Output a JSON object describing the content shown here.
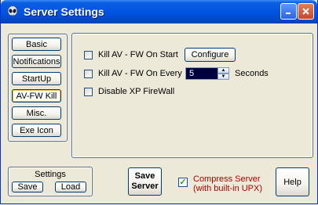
{
  "window": {
    "title": "Server Settings"
  },
  "tabs": [
    {
      "label": "Basic"
    },
    {
      "label": "Notifications"
    },
    {
      "label": "StartUp"
    },
    {
      "label": "AV-FW Kill",
      "active": true
    },
    {
      "label": "Misc."
    },
    {
      "label": "Exe Icon"
    }
  ],
  "av_fw": {
    "kill_on_start_label": "Kill AV - FW On Start",
    "configure_label": "Configure",
    "kill_every_label": "Kill AV - FW On Every",
    "kill_every_value": "5",
    "seconds_label": "Seconds",
    "disable_firewall_label": "Disable XP FireWall"
  },
  "settings": {
    "title": "Settings",
    "save_label": "Save",
    "load_label": "Load"
  },
  "footer": {
    "save_server_line1": "Save",
    "save_server_line2": "Server",
    "compress_line1": "Compress Server",
    "compress_line2": "(with built-in UPX)",
    "compress_checked": true,
    "help_label": "Help"
  },
  "colors": {
    "titlebar": "#0054e3",
    "spin_bg": "#000040",
    "compress_text": "#b00000",
    "check_mark": "#21a121"
  }
}
